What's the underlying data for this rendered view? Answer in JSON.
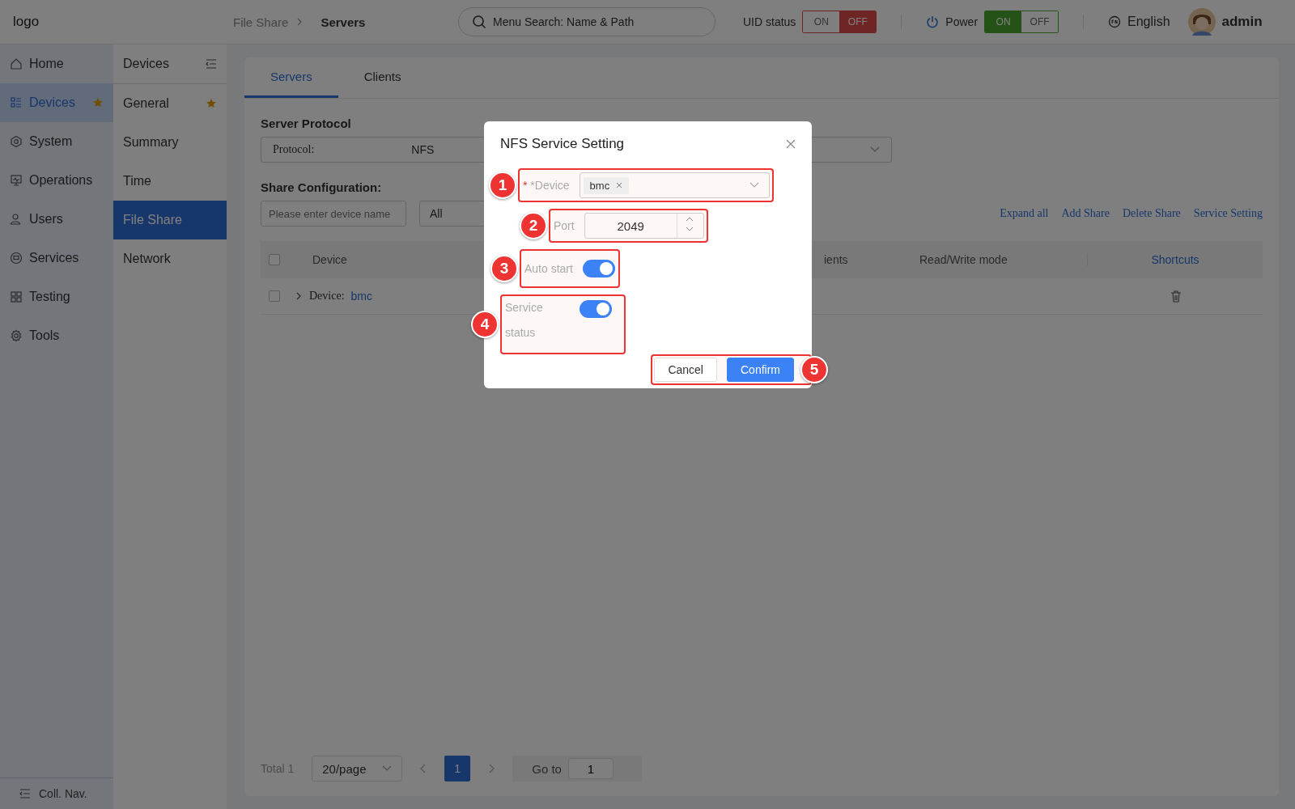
{
  "header": {
    "logo_alt": "logo",
    "breadcrumb": [
      {
        "label": "File Share"
      },
      {
        "label": "Servers"
      }
    ],
    "search": {
      "placeholder": "Menu Search: Name & Path"
    },
    "uid_status": {
      "label": "UID status",
      "options": [
        {
          "label": "ON",
          "selected": false
        },
        {
          "label": "OFF",
          "selected": true
        }
      ]
    },
    "power": {
      "label": "Power",
      "options": [
        {
          "label": "ON",
          "selected": true
        },
        {
          "label": "OFF",
          "selected": false
        }
      ]
    },
    "language": "English",
    "user": "admin"
  },
  "nav": {
    "items": [
      {
        "label": "Home",
        "selected": false,
        "starred": false
      },
      {
        "label": "Devices",
        "selected": true,
        "starred": true
      },
      {
        "label": "System",
        "selected": false,
        "starred": false
      },
      {
        "label": "Operations",
        "selected": false,
        "starred": false
      },
      {
        "label": "Users",
        "selected": false,
        "starred": false
      },
      {
        "label": "Services",
        "selected": false,
        "starred": false
      },
      {
        "label": "Testing",
        "selected": false,
        "starred": false
      },
      {
        "label": "Tools",
        "selected": false,
        "starred": false
      }
    ],
    "collapse": "Coll. Nav."
  },
  "subnav": {
    "title": "Devices",
    "items": [
      {
        "label": "General",
        "selected": false,
        "starred": true
      },
      {
        "label": "Summary",
        "selected": false,
        "starred": false
      },
      {
        "label": "Time",
        "selected": false,
        "starred": false
      },
      {
        "label": "File Share",
        "selected": true,
        "starred": false
      },
      {
        "label": "Network",
        "selected": false,
        "starred": false
      }
    ]
  },
  "tabs": [
    {
      "label": "Servers",
      "selected": true
    },
    {
      "label": "Clients",
      "selected": false
    }
  ],
  "server_protocol": {
    "heading": "Server Protocol",
    "label": "Protocol:",
    "value": "NFS"
  },
  "share_config": {
    "heading": "Share Configuration:",
    "search_placeholder": "Please enter device name",
    "filter": "All",
    "links": [
      "Expand all",
      "Add Share",
      "Delete Share",
      "Service Setting"
    ]
  },
  "table": {
    "select_all_checked": false,
    "columns": [
      "Device",
      "ients",
      "Read/Write mode",
      "Shortcuts"
    ],
    "rows": [
      {
        "label": "Device:",
        "value": "bmc",
        "expanded": false,
        "checked": false
      }
    ]
  },
  "pagination": {
    "total": "Total 1",
    "page_size": "20/page",
    "pages": [
      {
        "label": "1",
        "selected": true
      }
    ],
    "goto_label": "Go to",
    "goto_value": "1"
  },
  "dialog": {
    "title": "NFS Service Setting",
    "device": {
      "required_mark": "*",
      "label": "*Device",
      "tags": [
        "bmc"
      ],
      "callout": "1"
    },
    "port": {
      "label": "Port",
      "value": "2049",
      "callout": "2"
    },
    "switches": [
      {
        "label": "Auto start",
        "on": true,
        "callout": "3"
      },
      {
        "label": "Service status",
        "on": true,
        "callout": "4"
      }
    ],
    "buttons": [
      {
        "label": "Cancel",
        "kind": "default"
      },
      {
        "label": "Confirm",
        "kind": "primary"
      }
    ],
    "buttons_callout": "5"
  }
}
